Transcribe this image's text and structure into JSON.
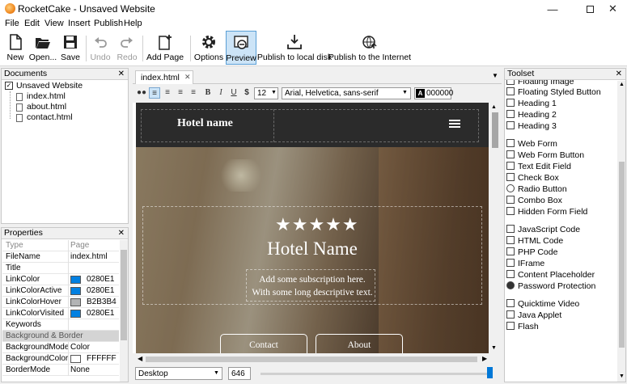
{
  "window": {
    "title": "RocketCake - Unsaved Website"
  },
  "menu": [
    "File",
    "Edit",
    "View",
    "Insert",
    "Publish",
    "Help"
  ],
  "toolbar": {
    "new": "New",
    "open": "Open...",
    "save": "Save",
    "undo": "Undo",
    "redo": "Redo",
    "add_page": "Add Page",
    "options": "Options",
    "preview": "Preview",
    "publish_local": "Publish to local disk",
    "publish_internet": "Publish to the Internet"
  },
  "documents": {
    "title": "Documents",
    "root": "Unsaved Website",
    "pages": [
      "index.html",
      "about.html",
      "contact.html"
    ]
  },
  "properties": {
    "title": "Properties",
    "header": {
      "k": "Type",
      "v": "Page"
    },
    "rows": [
      {
        "k": "FileName",
        "v": "index.html"
      },
      {
        "k": "Title",
        "v": ""
      },
      {
        "k": "LinkColor",
        "v": "0280E1",
        "color": "#0280E1"
      },
      {
        "k": "LinkColorActive",
        "v": "0280E1",
        "color": "#0280E1"
      },
      {
        "k": "LinkColorHover",
        "v": "B2B3B4",
        "color": "#B2B3B4"
      },
      {
        "k": "LinkColorVisited",
        "v": "0280E1",
        "color": "#0280E1"
      },
      {
        "k": "Keywords",
        "v": ""
      }
    ],
    "section": "Background & Border",
    "rows2": [
      {
        "k": "BackgroundMode",
        "v": "Color"
      },
      {
        "k": "BackgroundColor",
        "v": "FFFFFF",
        "color": "#FFFFFF"
      },
      {
        "k": "BorderMode",
        "v": "None"
      }
    ]
  },
  "editor": {
    "tab": "index.html",
    "font_size": "12",
    "font_family": "Arial, Helvetica, sans-serif",
    "color_code": "000000",
    "color_badge": "A"
  },
  "page": {
    "nav_title": "Hotel name",
    "stars": "★★★★★",
    "hero_title": "Hotel Name",
    "subtitle_1": "Add some subscription here.",
    "subtitle_2": "With some long descriptive text.",
    "btn_contact": "Contact",
    "btn_about": "About"
  },
  "bottom": {
    "device": "Desktop",
    "width": "646"
  },
  "toolset": {
    "title": "Toolset",
    "items": [
      "Floating Image",
      "Floating Styled Button",
      "Heading 1",
      "Heading 2",
      "Heading 3",
      "Web Form",
      "Web Form Button",
      "Text Edit Field",
      "Check Box",
      "Radio Button",
      "Combo Box",
      "Hidden Form Field",
      "JavaScript Code",
      "HTML Code",
      "PHP Code",
      "IFrame",
      "Content Placeholder",
      "Password Protection",
      "Quicktime Video",
      "Java Applet",
      "Flash"
    ]
  },
  "colors": {
    "accent": "#0280E1",
    "preview_active": "#cce4f7"
  }
}
